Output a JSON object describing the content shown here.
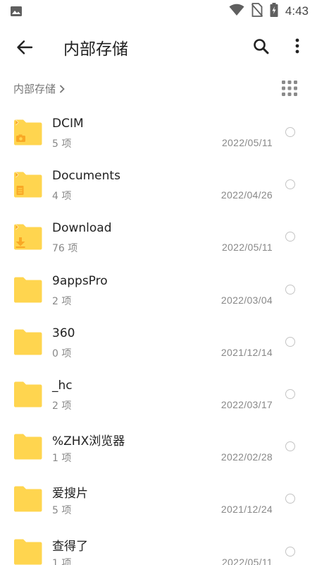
{
  "status_bar": {
    "time": "4:43",
    "icons": [
      "image-notification-icon",
      "wifi-icon",
      "no-sim-icon",
      "battery-charging-icon"
    ]
  },
  "toolbar": {
    "title": "内部存储",
    "back_icon": "arrow-back-icon",
    "search_icon": "search-icon",
    "more_icon": "more-vert-icon"
  },
  "breadcrumb": {
    "label": "内部存储",
    "view_icon": "grid-view-icon"
  },
  "colors": {
    "folder": "#FFD54F",
    "folder_badge": "#F9A825",
    "text_primary": "#222222",
    "text_secondary": "#888888"
  },
  "files": [
    {
      "name": "DCIM",
      "count": "5 项",
      "date": "2022/05/11",
      "icon": "camera-folder-icon"
    },
    {
      "name": "Documents",
      "count": "4 项",
      "date": "2022/04/26",
      "icon": "document-folder-icon"
    },
    {
      "name": "Download",
      "count": "76 项",
      "date": "2022/05/11",
      "icon": "download-folder-icon"
    },
    {
      "name": "9appsPro",
      "count": "2 项",
      "date": "2022/03/04",
      "icon": "folder-icon"
    },
    {
      "name": "360",
      "count": "0 项",
      "date": "2021/12/14",
      "icon": "folder-icon"
    },
    {
      "name": "_hc",
      "count": "2 项",
      "date": "2022/03/17",
      "icon": "folder-icon"
    },
    {
      "name": "%ZHX浏览器",
      "count": "1 项",
      "date": "2022/02/28",
      "icon": "folder-icon"
    },
    {
      "name": "爱搜片",
      "count": "5 项",
      "date": "2021/12/24",
      "icon": "folder-icon"
    },
    {
      "name": "查得了",
      "count": "1 项",
      "date": "2022/05/11",
      "icon": "folder-icon"
    }
  ]
}
